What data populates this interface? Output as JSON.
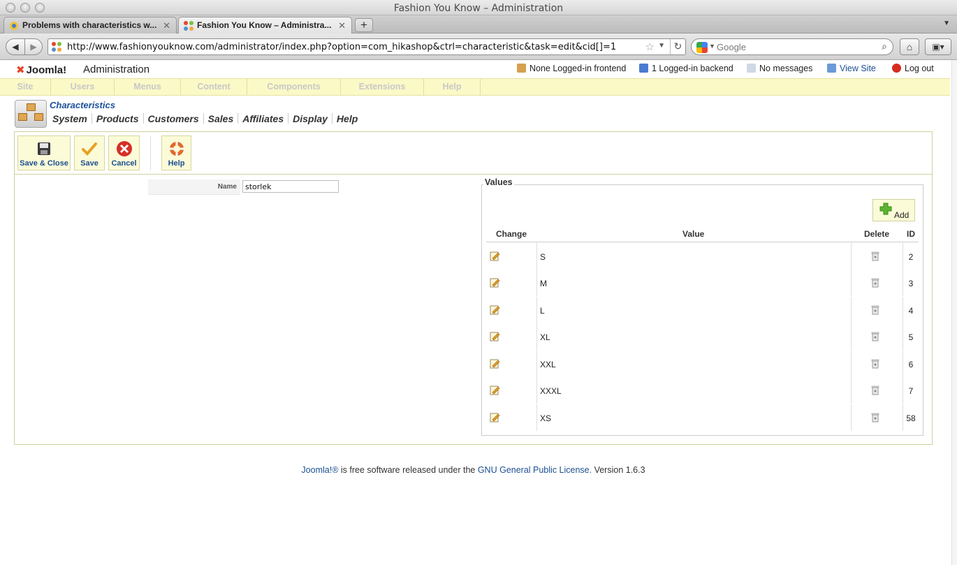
{
  "window": {
    "title": "Fashion You Know – Administration"
  },
  "tabs": [
    {
      "label": "Problems with characteristics w...",
      "active": false
    },
    {
      "label": "Fashion You Know – Administra...",
      "active": true
    }
  ],
  "navbar": {
    "url": "http://www.fashionyouknow.com/administrator/index.php?option=com_hikashop&ctrl=characteristic&task=edit&cid[]=1",
    "search_placeholder": "Google"
  },
  "header": {
    "logo": "Joomla!",
    "title": "Administration",
    "status": {
      "frontend": "None Logged-in frontend",
      "backend": "1 Logged-in backend",
      "messages": "No messages",
      "view_site": "View Site",
      "logout": "Log out"
    }
  },
  "menu": [
    "Site",
    "Users",
    "Menus",
    "Content",
    "Components",
    "Extensions",
    "Help"
  ],
  "component": {
    "title": "Characteristics",
    "submenu": [
      "System",
      "Products",
      "Customers",
      "Sales",
      "Affiliates",
      "Display",
      "Help"
    ]
  },
  "toolbar": {
    "save_close": "Save & Close",
    "save": "Save",
    "cancel": "Cancel",
    "help": "Help"
  },
  "form": {
    "name_label": "Name",
    "name_value": "storlek"
  },
  "values": {
    "legend": "Values",
    "add_label": "Add",
    "columns": {
      "change": "Change",
      "value": "Value",
      "delete": "Delete",
      "id": "ID"
    },
    "rows": [
      {
        "value": "S",
        "id": "2"
      },
      {
        "value": "M",
        "id": "3"
      },
      {
        "value": "L",
        "id": "4"
      },
      {
        "value": "XL",
        "id": "5"
      },
      {
        "value": "XXL",
        "id": "6"
      },
      {
        "value": "XXXL",
        "id": "7"
      },
      {
        "value": "XS",
        "id": "58"
      }
    ]
  },
  "footer": {
    "link1": "Joomla!®",
    "text1": " is free software released under the ",
    "link2": "GNU General Public License.",
    "text2": " Version 1.6.3"
  },
  "colors": {
    "menubar": "#fbf9c6",
    "link": "#1d4f91",
    "toolbar_button": "#fbfbd8"
  }
}
